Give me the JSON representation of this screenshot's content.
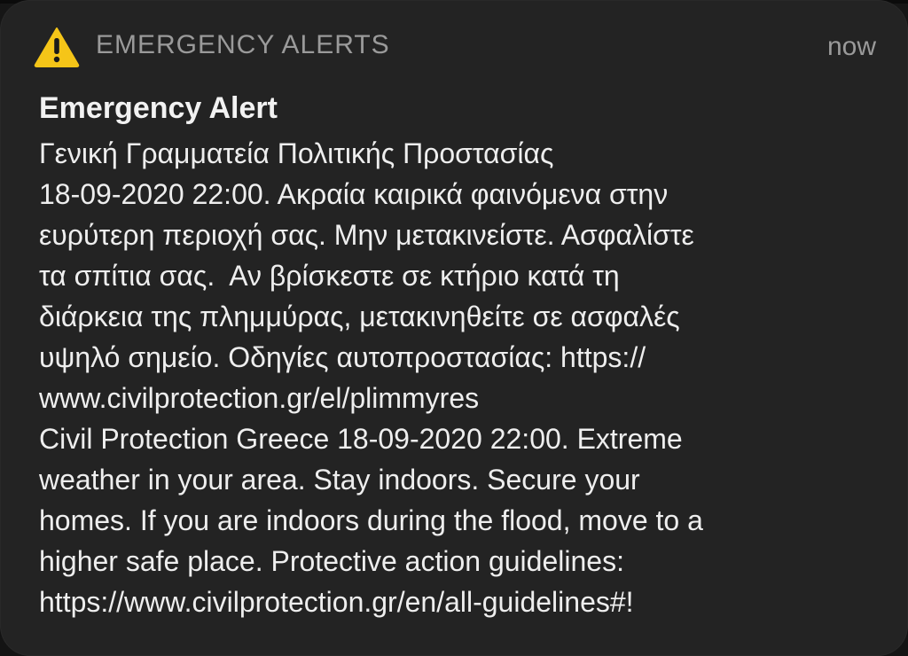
{
  "notification": {
    "app_name": "EMERGENCY ALERTS",
    "time": "now",
    "icon": "warning-triangle-icon",
    "accent_color": "#f5c518",
    "title": "Emergency Alert",
    "body_lines": [
      "Γενική Γραμματεία Πολιτικής Προστασίας",
      "18-09-2020 22:00. Ακραία καιρικά φαινόμενα στην",
      "ευρύτερη περιοχή σας. Μην μετακινείστε. Ασφαλίστε",
      "τα σπίτια σας.  Αν βρίσκεστε σε κτήριο κατά τη",
      "διάρκεια της πλημμύρας, μετακινηθείτε σε ασφαλές",
      "υψηλό σημείο. Οδηγίες αυτοπροστασίας: https://",
      "www.civilprotection.gr/el/plimmyres",
      "Civil Protection Greece 18-09-2020 22:00. Extreme",
      "weather in your area. Stay indoors. Secure your",
      "homes. If you are indoors during the flood, move to a",
      "higher safe place. Protective action guidelines:",
      "https://www.civilprotection.gr/en/all-guidelines#!"
    ]
  }
}
